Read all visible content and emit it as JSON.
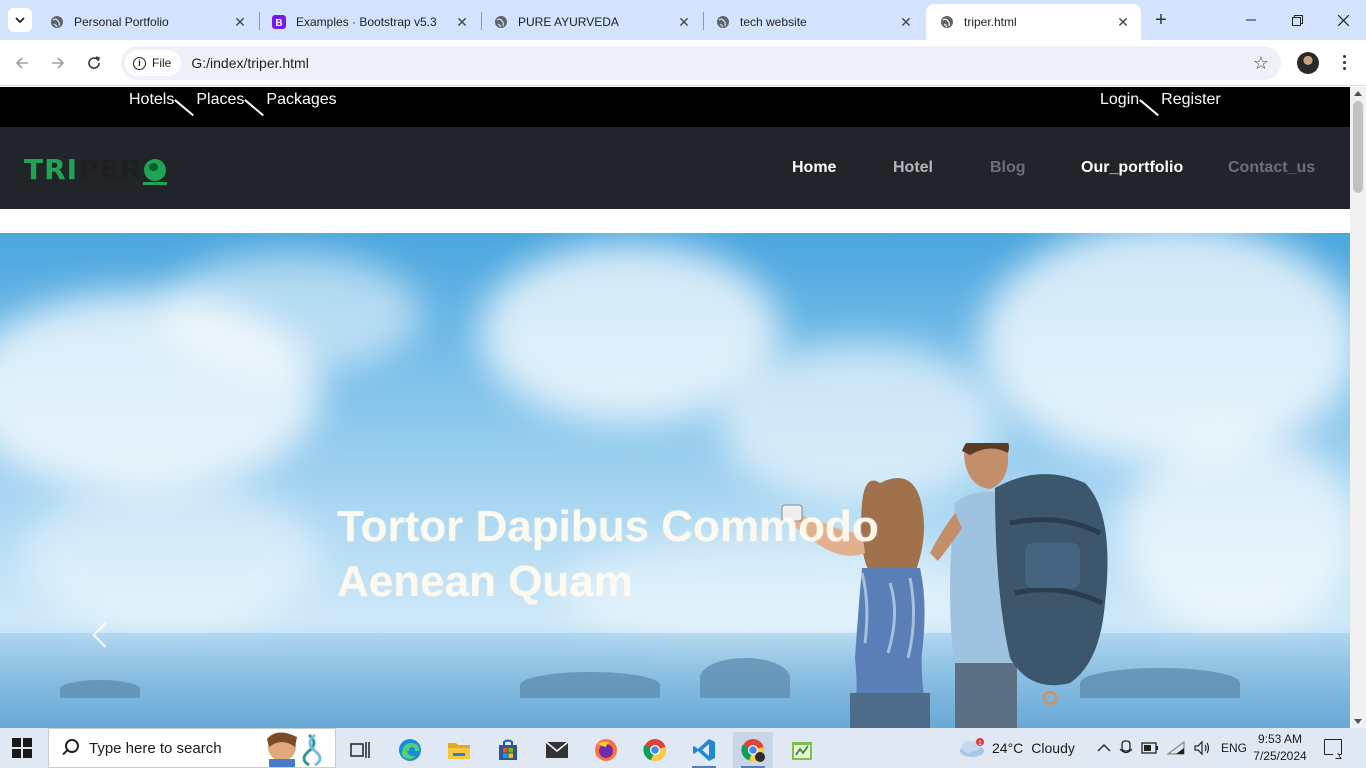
{
  "browser": {
    "tabs": [
      {
        "title": "Personal Portfolio",
        "favicon": "globe-icon",
        "active": false
      },
      {
        "title": "Examples · Bootstrap v5.3",
        "favicon": "bootstrap-icon",
        "active": false
      },
      {
        "title": "PURE AYURVEDA",
        "favicon": "globe-icon",
        "active": false
      },
      {
        "title": "tech website",
        "favicon": "globe-icon",
        "active": false
      },
      {
        "title": "triper.html",
        "favicon": "globe-icon",
        "active": true
      }
    ],
    "address": {
      "chip_label": "File",
      "url": "G:/index/triper.html"
    }
  },
  "page": {
    "topbar": {
      "left_links": [
        "Hotels",
        "Places",
        "Packages"
      ],
      "right_links": [
        "Login",
        "Register"
      ]
    },
    "logo": {
      "part1": "TRI",
      "part2": "PER"
    },
    "nav": {
      "home": "Home",
      "hotel": "Hotel",
      "blog": "Blog",
      "portfolio": "Our_portfolio",
      "contact": "Contact_us"
    },
    "hero": {
      "title_line1": "Tortor Dapibus Commodo",
      "title_line2": "Aenean Quam"
    }
  },
  "taskbar": {
    "search_placeholder": "Type here to search",
    "weather": {
      "temp": "24°C",
      "condition": "Cloudy",
      "badge": "1"
    },
    "language": "ENG",
    "time": "9:53 AM",
    "date": "7/25/2024"
  },
  "colors": {
    "tab_strip": "#d3e3fd",
    "topbar_bg": "#000000",
    "nav_bg": "#212529",
    "logo_green": "#1fa455",
    "taskbar_bg": "#dfe8f3"
  }
}
